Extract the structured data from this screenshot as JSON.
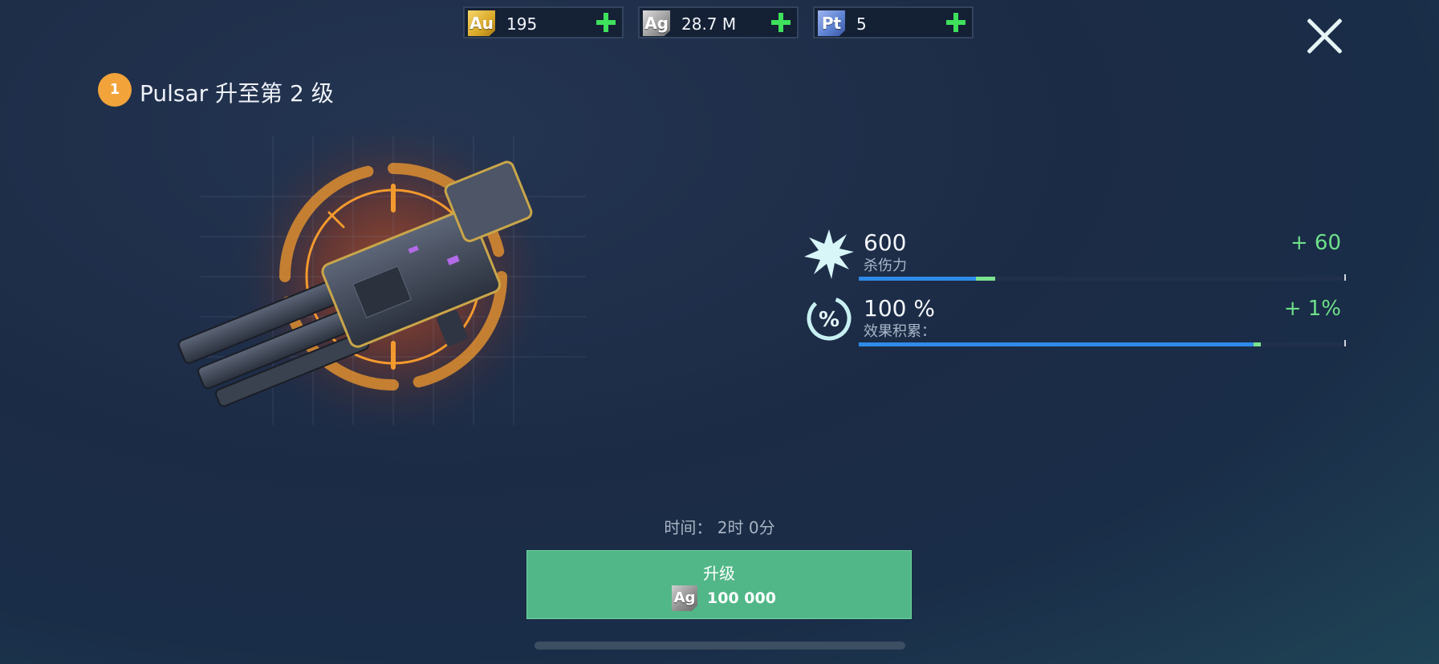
{
  "resources": [
    {
      "code": "Au",
      "value": "195",
      "color": "#e6b830"
    },
    {
      "code": "Ag",
      "value": "28.7 M",
      "color": "#a8a8a8"
    },
    {
      "code": "Pt",
      "value": "5",
      "color": "#5a7fd0"
    }
  ],
  "header": {
    "step_number": "1",
    "title": "Pulsar 升至第 2 级"
  },
  "stats": [
    {
      "value": "600",
      "label": "杀伤力",
      "bonus": "+ 60",
      "current_fraction": 0.24,
      "bonus_fraction": 0.04,
      "icon": "starburst-icon"
    },
    {
      "value": "100 %",
      "label": "效果积累：",
      "bonus": "+ 1%",
      "current_fraction": 0.81,
      "bonus_fraction": 0.015,
      "icon": "percent-ring-icon"
    }
  ],
  "upgrade": {
    "time_text": "时间： 2时 0分",
    "button_label": "升级",
    "cost_currency": "Ag",
    "cost_value": "100 000"
  },
  "colors": {
    "accent_green": "#52b788",
    "bonus_green": "#6ee08a",
    "progress_blue": "#2e8be8",
    "step_orange": "#f2a33a"
  }
}
